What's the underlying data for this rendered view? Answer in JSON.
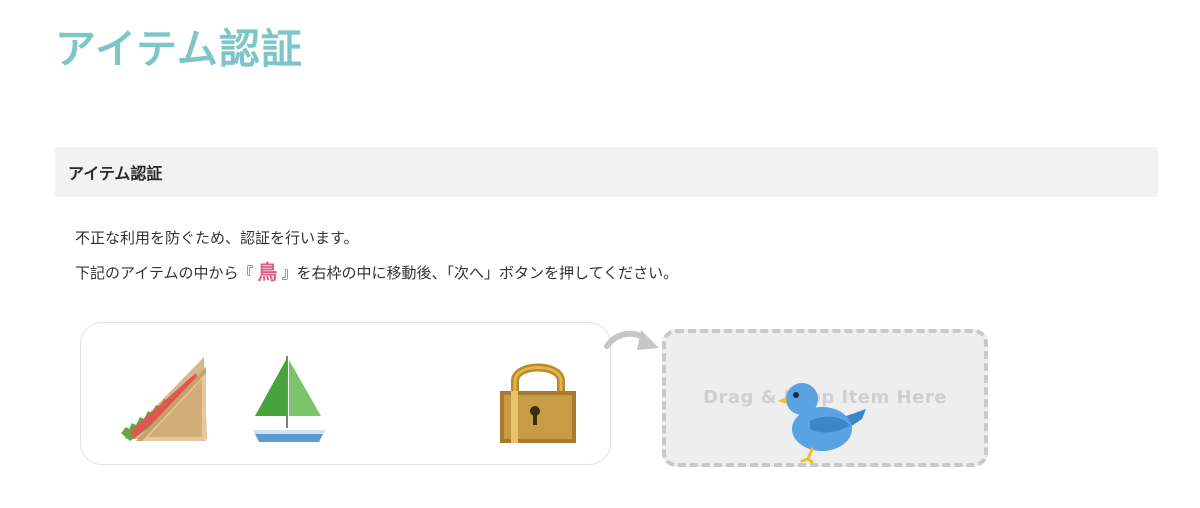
{
  "page": {
    "title": "アイテム認証"
  },
  "section": {
    "header": "アイテム認証"
  },
  "instructions": {
    "line1": "不正な利用を防ぐため、認証を行います。",
    "line2_before": "下記のアイテムの中から『",
    "target_item": "鳥",
    "line2_after": "』を右枠の中に移動後、「次へ」ボタンを押してください。"
  },
  "items": [
    {
      "icon": "sandwich-icon"
    },
    {
      "icon": "sailboat-icon"
    },
    {
      "icon": "padlock-icon"
    }
  ],
  "drop_zone": {
    "label": "Drag & Drop Item Here",
    "dropped_item": "bird-icon"
  },
  "colors": {
    "title": "#7cc6c9",
    "target_word": "#e05f8a",
    "header_bg": "#f2f2f2",
    "drop_border": "#c9c9c9",
    "drop_bg": "#eeeeee"
  }
}
